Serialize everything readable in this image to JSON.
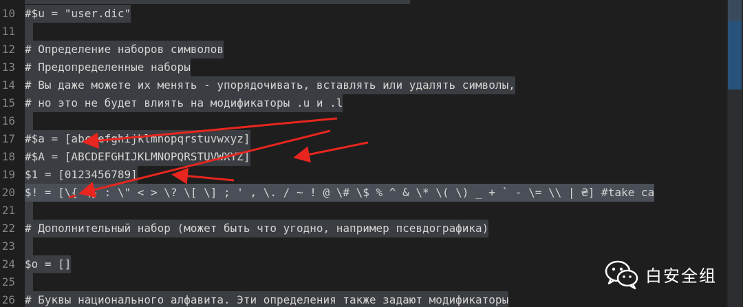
{
  "editor": {
    "lines": [
      {
        "num": "10",
        "text": "#$u = \"user.dic\""
      },
      {
        "num": "11",
        "text": ""
      },
      {
        "num": "12",
        "text": "# Определение наборов символов"
      },
      {
        "num": "13",
        "text": "# Предопределенные наборы"
      },
      {
        "num": "14",
        "text": "# Вы даже можете их менять - упорядочивать, вставлять или удалять символы,"
      },
      {
        "num": "15",
        "text": "# но это не будет влиять на модификаторы .u и .l"
      },
      {
        "num": "16",
        "text": ""
      },
      {
        "num": "17",
        "text": "#$a = [abcdefghijklmnopqrstuvwxyz]"
      },
      {
        "num": "18",
        "text": "#$A = [ABCDEFGHIJKLMNOPQRSTUVWXYZ]"
      },
      {
        "num": "19",
        "text": "$1 = [0123456789]"
      },
      {
        "num": "20",
        "text": "$! = [\\{ \\} : \\\" < > \\? \\[ \\] ; ' , \\. / ~ ! @ \\# \\$ % ^ & \\* \\( \\) _ + ` - \\= \\\\ | ₴] #take ca"
      },
      {
        "num": "21",
        "text": ""
      },
      {
        "num": "22",
        "text": "# Дополнительный набор (может быть что угодно, например псевдографика)"
      },
      {
        "num": "23",
        "text": ""
      },
      {
        "num": "24",
        "text": "$o = []"
      },
      {
        "num": "25",
        "text": ""
      },
      {
        "num": "26",
        "text": "# Буквы национального алфавита. Эти определения также задают модификаторы"
      }
    ]
  },
  "watermark": {
    "text": "白安全组",
    "icon": "wechat-icon"
  },
  "colors": {
    "background": "#1e1e1e",
    "selection": "#3a3d41",
    "line_number": "#858585",
    "text": "#d4d4d4",
    "arrow": "#e8261f",
    "minimap_accent": "#2a5a8a"
  }
}
